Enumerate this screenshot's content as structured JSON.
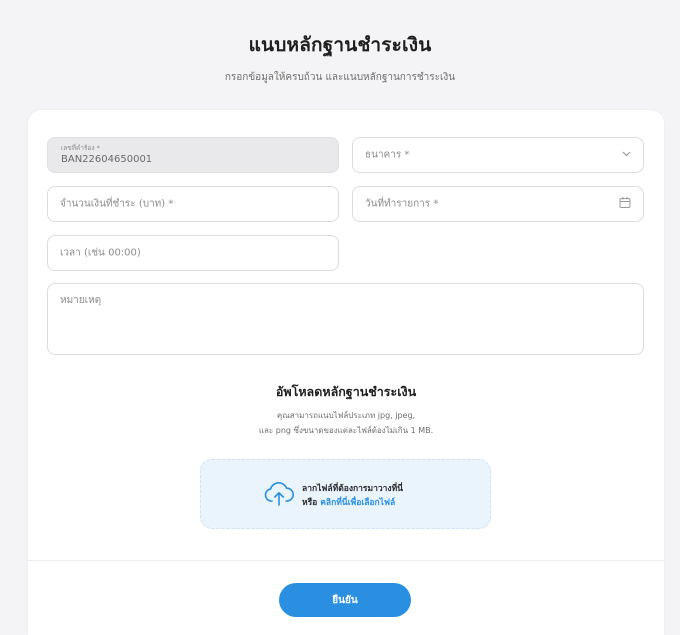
{
  "header": {
    "title": "แนบหลักฐานชำระเงิน",
    "subtitle": "กรอกข้อมูลให้ครบถ้วน และแนบหลักฐานการชำระเงิน"
  },
  "form": {
    "reference": {
      "label": "เลขที่คำร้อง *",
      "value": "BAN22604650001"
    },
    "bank": {
      "placeholder": "ธนาคาร *"
    },
    "amount": {
      "placeholder": "จำนวนเงินที่ชำระ (บาท) *"
    },
    "date": {
      "placeholder": "วันที่ทำรายการ *"
    },
    "time": {
      "placeholder": "เวลา (เช่น 00:00)"
    },
    "note": {
      "placeholder": "หมายเหตุ"
    }
  },
  "upload": {
    "title": "อัพโหลดหลักฐานชำระเงิน",
    "desc_line1": "คุณสามารถแนบไฟล์ประเภท jpg, jpeg,",
    "desc_line2": "และ png ซึ่งขนาดของแต่ละไฟล์ต้องไม่เกิน 1 MB.",
    "drop_text": "ลากไฟล์ที่ต้องการมาวางที่นี่",
    "or_text": "หรือ",
    "browse_link": "คลิกที่นี่เพื่อเลือกไฟล์",
    "icon": "cloud-upload-icon"
  },
  "footer": {
    "confirm_label": "ยืนยัน"
  },
  "colors": {
    "accent": "#2a8fe0",
    "dropzone_bg": "#e9f4fc",
    "page_bg": "#f4f4f6"
  }
}
